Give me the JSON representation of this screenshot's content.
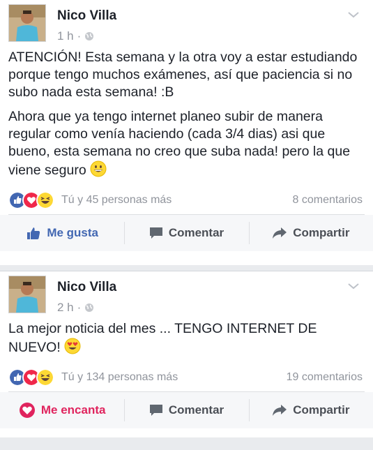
{
  "posts": [
    {
      "author": "Nico Villa",
      "time": "1 h",
      "time_sep": "·",
      "paragraphs": [
        "ATENCIÓN! Esta semana y la otra voy a estar estudiando porque tengo muchos exámenes, así que paciencia si no subo nada esta semana! :B",
        "Ahora que ya tengo internet planeo subir de manera regular como venía haciendo (cada 3/4 dias) asi que bueno, esta semana no creo que suba nada! pero la que viene seguro"
      ],
      "reactions_text": "Tú y 45 personas más",
      "comments": "8 comentarios",
      "actions": {
        "react": "Me gusta",
        "comment": "Comentar",
        "share": "Compartir"
      }
    },
    {
      "author": "Nico Villa",
      "time": "2 h",
      "time_sep": "·",
      "paragraphs": [
        "La mejor noticia del mes ... TENGO INTERNET DE NUEVO!"
      ],
      "reactions_text": "Tú y 134 personas más",
      "comments": "19 comentarios",
      "actions": {
        "react": "Me encanta",
        "comment": "Comentar",
        "share": "Compartir"
      }
    }
  ],
  "colors": {
    "like_blue": "#4267b2",
    "love_red": "#e0245e",
    "meta_gray": "#90949c"
  }
}
